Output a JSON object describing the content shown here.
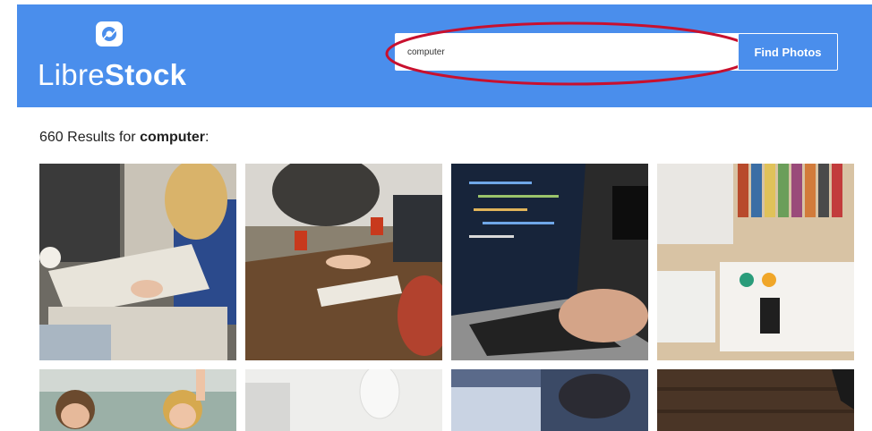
{
  "brand": {
    "name_light": "Libre",
    "name_bold": "Stock",
    "accent_color": "#4a8eec"
  },
  "search": {
    "value": "computer",
    "button_label": "Find Photos"
  },
  "results": {
    "count_text": "660 Results for ",
    "query": "computer",
    "suffix": ":"
  },
  "photos": [
    {
      "subject": "people-writing-with-laptop"
    },
    {
      "subject": "people-at-table-with-laptop"
    },
    {
      "subject": "laptop-with-code-typing"
    },
    {
      "subject": "desk-with-books-and-laptop"
    },
    {
      "subject": "kids-raising-hands"
    },
    {
      "subject": "white-keyboard-and-mouse"
    },
    {
      "subject": "person-at-monitor"
    },
    {
      "subject": "wooden-desk-with-device"
    }
  ]
}
